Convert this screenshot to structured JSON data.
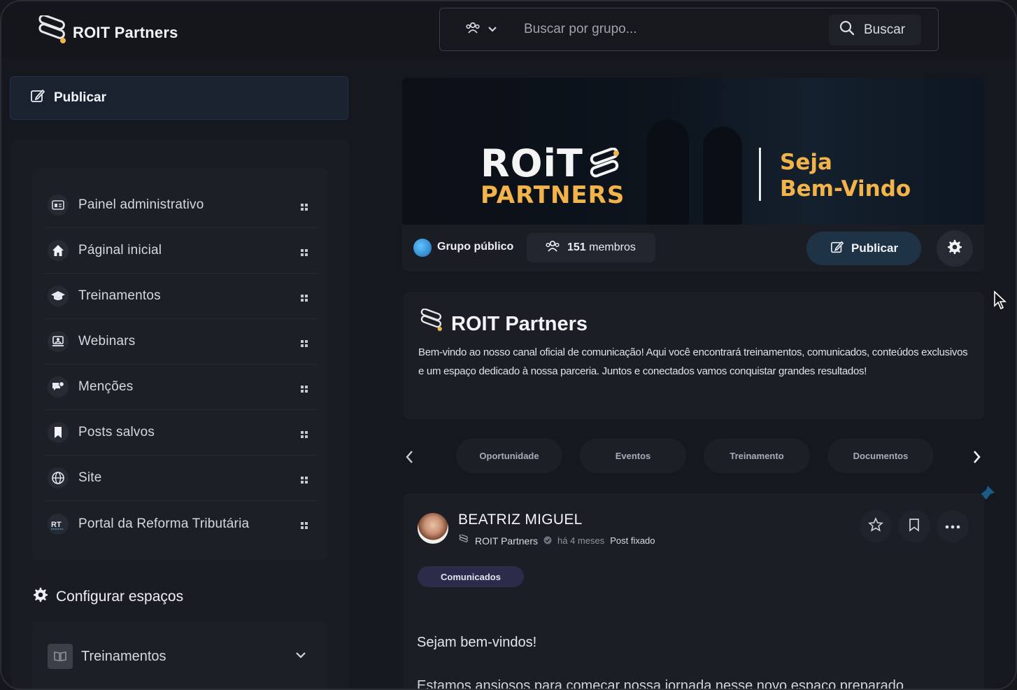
{
  "brand": {
    "name": "ROIT Partners"
  },
  "search": {
    "placeholder": "Buscar por grupo...",
    "button_label": "Buscar"
  },
  "sidebar": {
    "publish_label": "Publicar",
    "items": [
      {
        "label": "Painel administrativo",
        "icon": "dashboard-icon"
      },
      {
        "label": "Páginal inicial",
        "icon": "home-icon"
      },
      {
        "label": "Treinamentos",
        "icon": "graduation-cap-icon"
      },
      {
        "label": "Webinars",
        "icon": "presentation-icon"
      },
      {
        "label": "Menções",
        "icon": "mention-icon"
      },
      {
        "label": "Posts salvos",
        "icon": "bookmark-icon"
      },
      {
        "label": "Site",
        "icon": "globe-icon"
      },
      {
        "label": "Portal da Reforma Tributária",
        "icon": "rt-icon"
      }
    ],
    "config_label": "Configurar espaços",
    "spaces": [
      {
        "label": "Treinamentos",
        "icon": "book-icon"
      }
    ]
  },
  "banner": {
    "logo_line1": "ROiT",
    "logo_line2": "PARTNERS",
    "welcome_line1": "Seja",
    "welcome_line2": "Bem-Vindo",
    "group_type": "Grupo público",
    "members_count": "151",
    "members_label": "membros",
    "publish_label": "Publicar"
  },
  "about": {
    "title": "ROIT Partners",
    "description": "Bem-vindo ao nosso canal oficial de comunicação! Aqui você encontrará treinamentos, comunicados, conteúdos exclusivos e um espaço dedicado à nossa parceria. Juntos e conectados vamos conquistar grandes resultados!"
  },
  "tabs": [
    "Oportunidade",
    "Eventos",
    "Treinamento",
    "Documentos"
  ],
  "post": {
    "author": "BEATRIZ MIGUEL",
    "group": "ROIT Partners",
    "time": "há 4 meses",
    "pinned_label": "Post fixado",
    "tag": "Comunicados",
    "body_line1": "Sejam bem-vindos!",
    "body_line2": "Estamos ansiosos para começar nossa jornada nesse novo espaço preparado"
  },
  "colors": {
    "accent_gold": "#f2b34a",
    "background": "#15181f",
    "publish_button": "#1f3347"
  }
}
